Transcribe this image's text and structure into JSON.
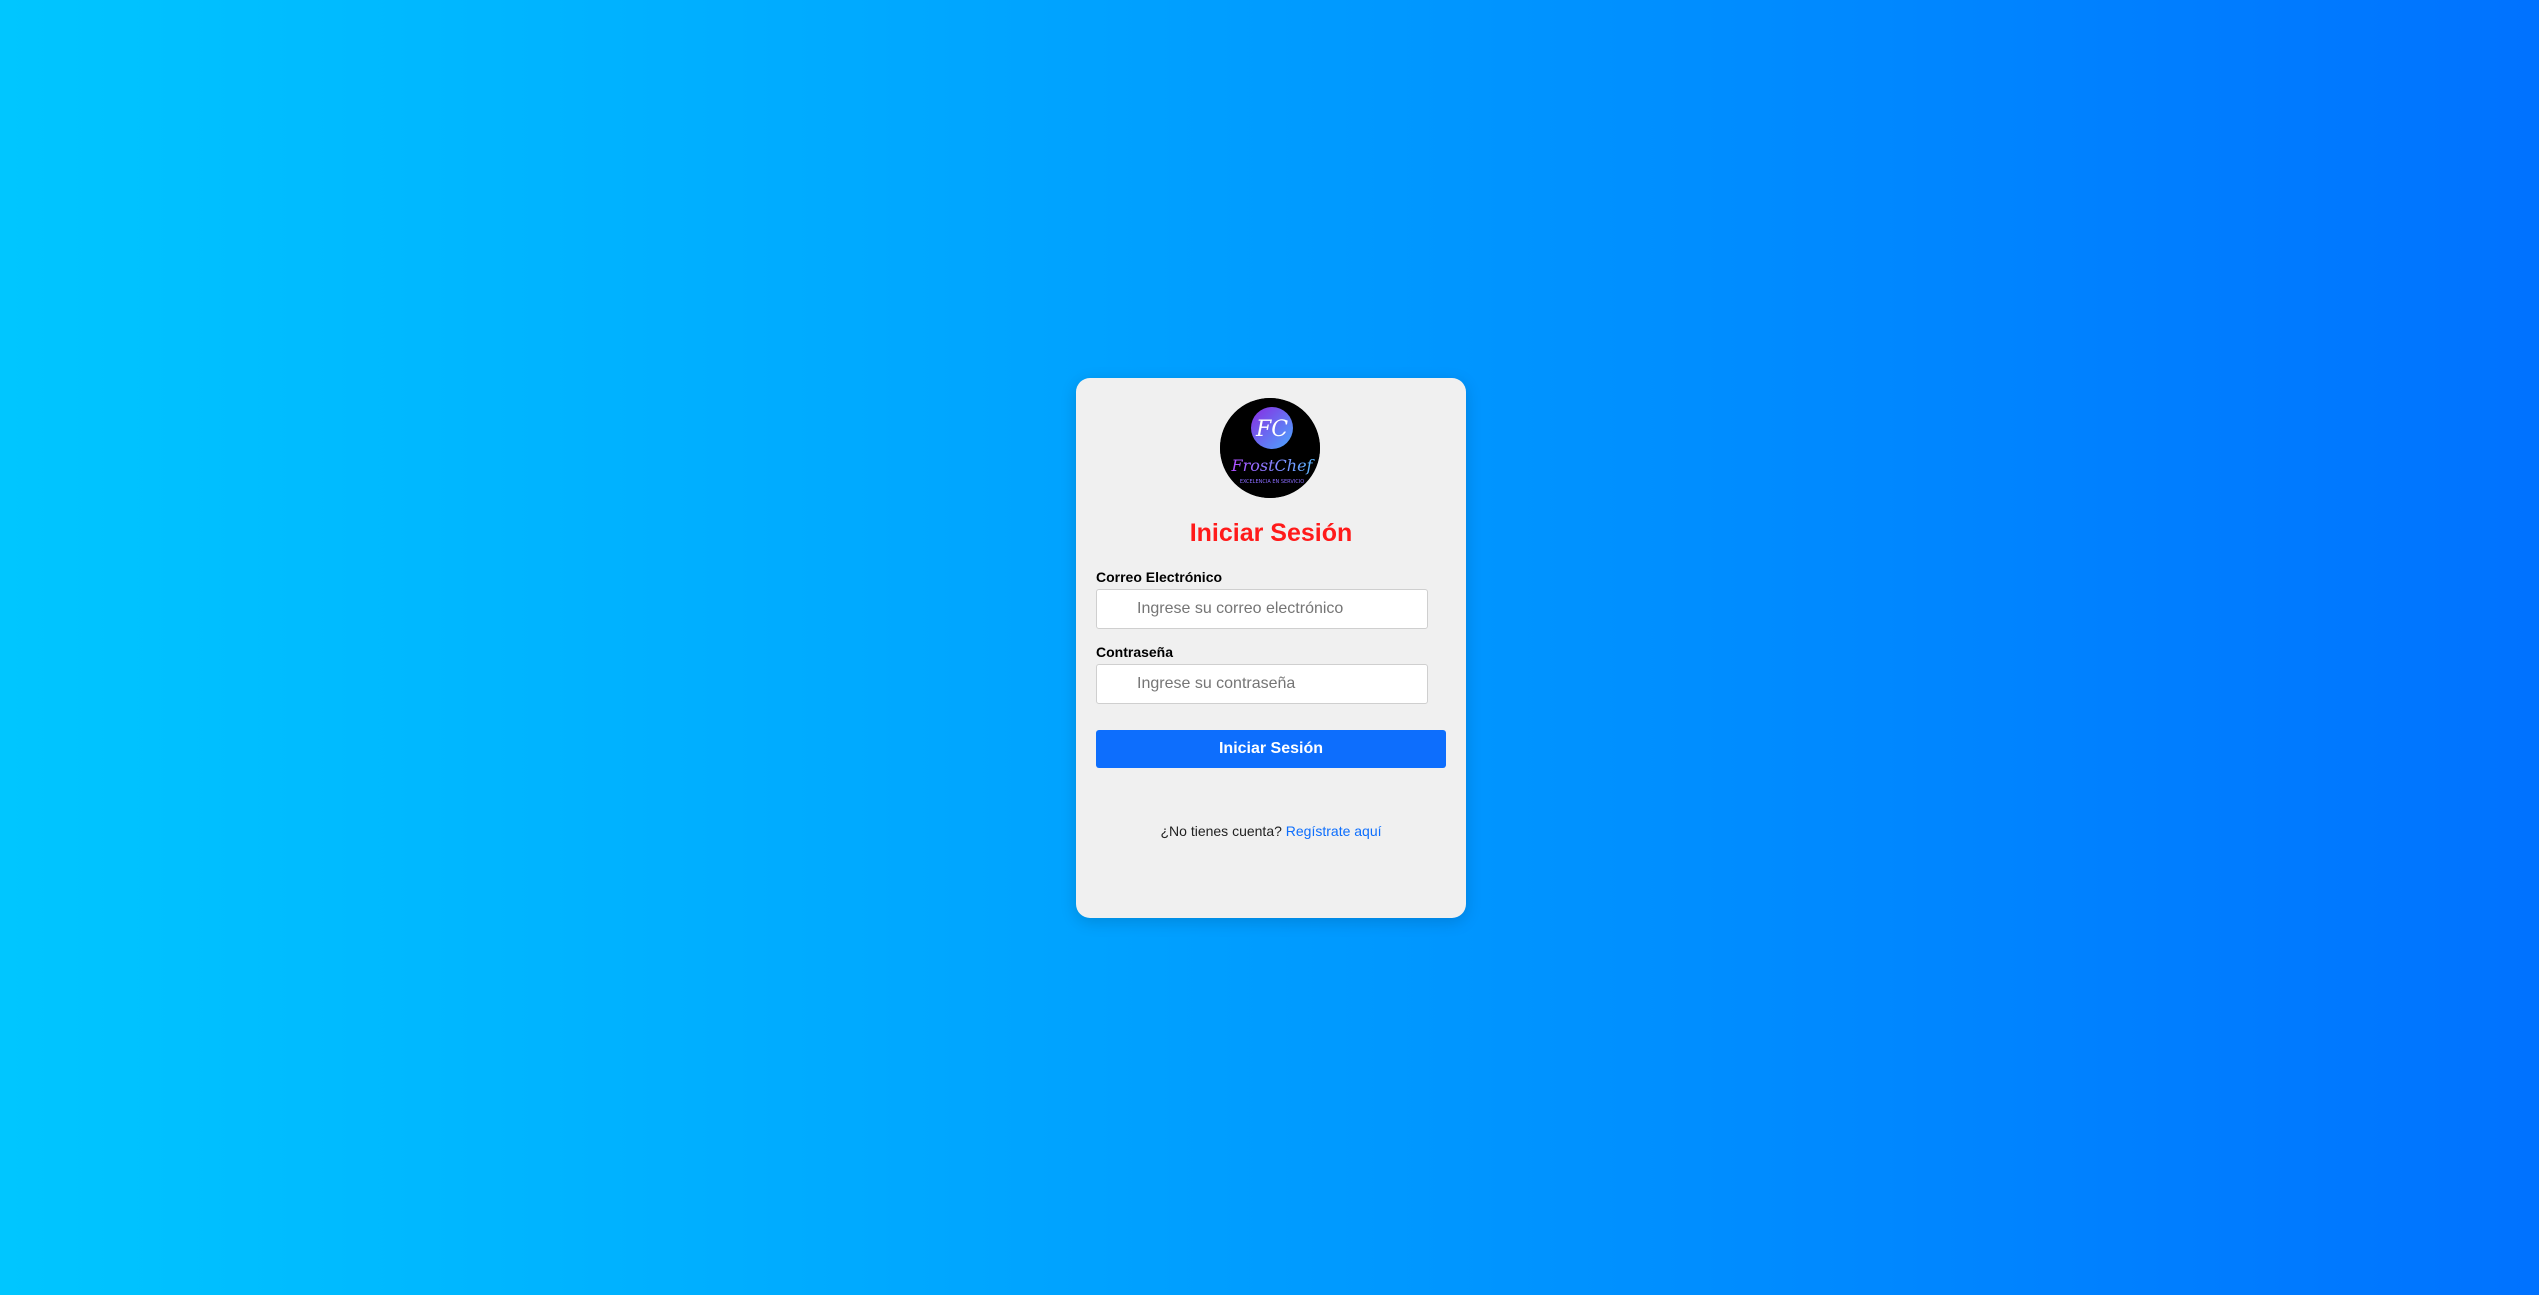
{
  "logo": {
    "monogram": "FC",
    "brand": "FrostChef",
    "tagline": "EXCELENCIA EN SERVICIO"
  },
  "login": {
    "title": "Iniciar Sesión",
    "email_label": "Correo Electrónico",
    "email_placeholder": "Ingrese su correo electrónico",
    "email_value": "",
    "password_label": "Contraseña",
    "password_placeholder": "Ingrese su contraseña",
    "password_value": "",
    "submit_label": "Iniciar Sesión",
    "signup_prompt": "¿No tienes cuenta?",
    "signup_link": "Regístrate aquí"
  },
  "colors": {
    "background_start": "#00c6ff",
    "background_end": "#0072ff",
    "title": "#ff1a1a",
    "button": "#0d6efd",
    "link": "#0d6efd",
    "card": "#f0f0f0"
  }
}
